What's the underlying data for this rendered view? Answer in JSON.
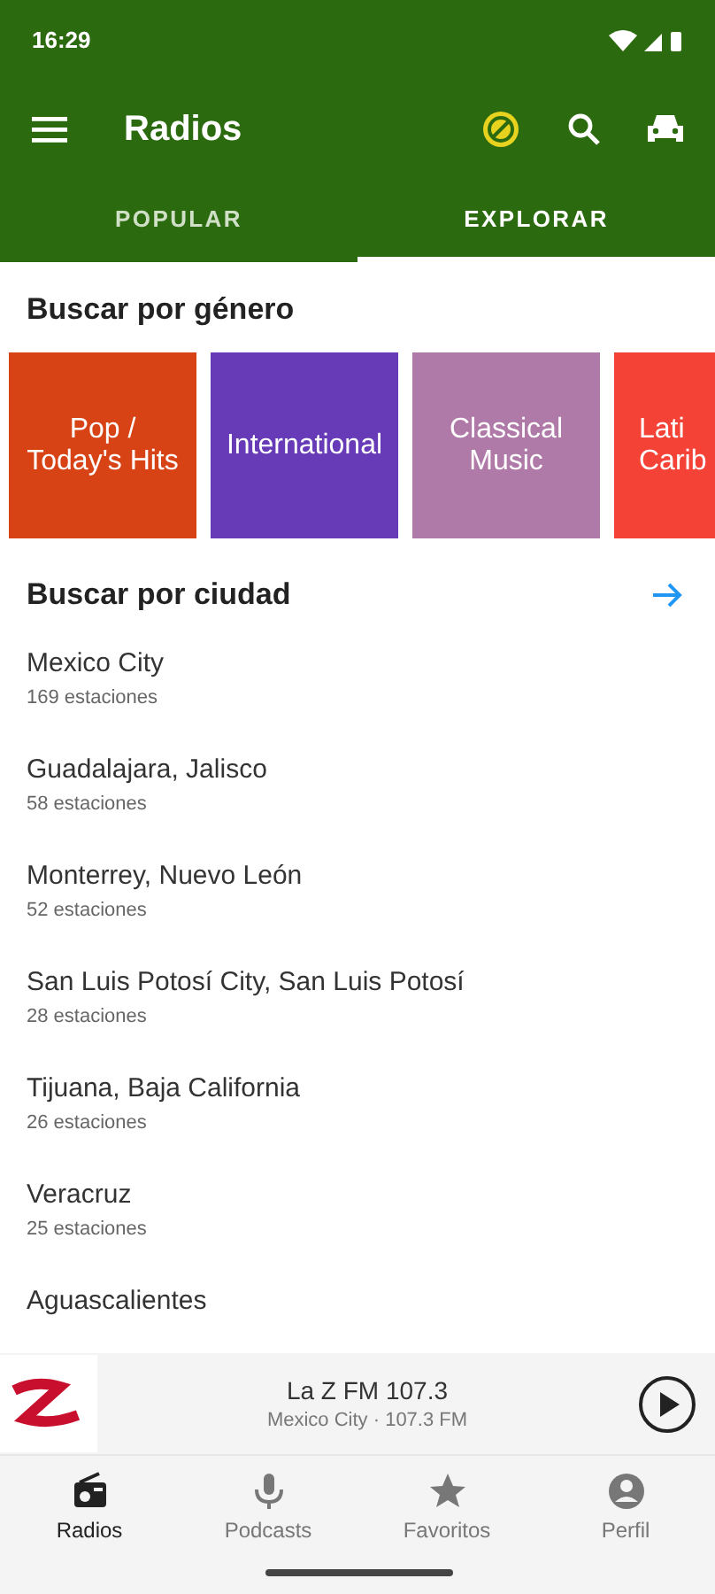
{
  "status_bar": {
    "time": "16:29"
  },
  "toolbar": {
    "title": "Radios"
  },
  "tabs": [
    {
      "label": "POPULAR",
      "selected": false
    },
    {
      "label": "EXPLORAR",
      "selected": true
    }
  ],
  "genres": {
    "title": "Buscar por género",
    "items": [
      {
        "lines": [
          "Pop /",
          "Today's Hits"
        ],
        "color": "#d84315"
      },
      {
        "lines": [
          "International"
        ],
        "color": "#673ab7"
      },
      {
        "lines": [
          "Classical",
          "Music"
        ],
        "color": "#b07aa8"
      },
      {
        "lines": [
          "Lati",
          "Carib"
        ],
        "color": "#f44336"
      }
    ]
  },
  "cities": {
    "title": "Buscar por ciudad",
    "items": [
      {
        "name": "Mexico City",
        "count": "169 estaciones"
      },
      {
        "name": "Guadalajara, Jalisco",
        "count": "58 estaciones"
      },
      {
        "name": "Monterrey, Nuevo León",
        "count": "52 estaciones"
      },
      {
        "name": "San Luis Potosí City, San Luis Potosí",
        "count": "28 estaciones"
      },
      {
        "name": "Tijuana, Baja California",
        "count": "26 estaciones"
      },
      {
        "name": "Veracruz",
        "count": "25 estaciones"
      },
      {
        "name": "Aguascalientes"
      }
    ]
  },
  "player": {
    "title": "La Z FM 107.3",
    "subtitle": "Mexico City · 107.3 FM"
  },
  "nav": [
    {
      "label": "Radios",
      "selected": true
    },
    {
      "label": "Podcasts",
      "selected": false
    },
    {
      "label": "Favoritos",
      "selected": false
    },
    {
      "label": "Perfil",
      "selected": false
    }
  ]
}
